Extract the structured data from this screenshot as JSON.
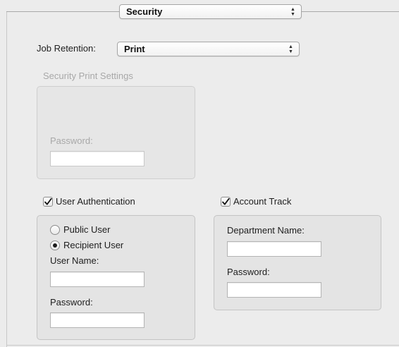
{
  "section_popup": {
    "value": "Security"
  },
  "job_retention": {
    "label": "Job Retention:",
    "value": "Print"
  },
  "security_print": {
    "title": "Security Print Settings",
    "password_label": "Password:",
    "password_value": ""
  },
  "user_auth": {
    "checkbox_label": "User Authentication",
    "checked": true,
    "options": [
      {
        "label": "Public User",
        "selected": false
      },
      {
        "label": "Recipient User",
        "selected": true
      }
    ],
    "username_label": "User Name:",
    "username_value": "",
    "password_label": "Password:",
    "password_value": ""
  },
  "account_track": {
    "checkbox_label": "Account Track",
    "checked": true,
    "department_label": "Department Name:",
    "department_value": "",
    "password_label": "Password:",
    "password_value": ""
  },
  "icons": {
    "popup_arrows": "up-down-arrows-icon",
    "checkmark": "checkmark-icon",
    "radio_dot": "radio-selected-icon"
  },
  "colors": {
    "window_bg": "#ececec",
    "group_bg": "#e4e4e4",
    "disabled_text": "#a8a8a8"
  }
}
